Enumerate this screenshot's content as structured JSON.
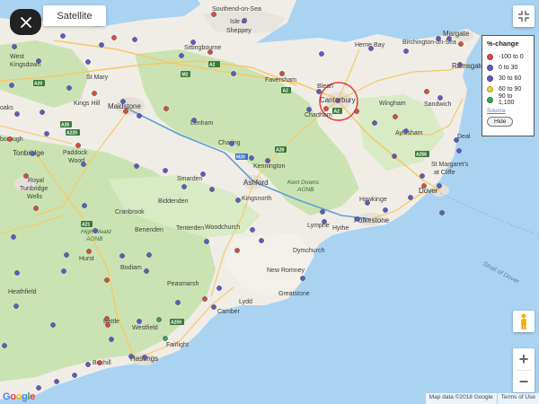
{
  "controls": {
    "satellite_label": "Satellite",
    "source_label": "Source",
    "hide_label": "Hide",
    "zoom_in": "+",
    "zoom_out": "−"
  },
  "legend": {
    "title": "%-change",
    "items": [
      {
        "label": "-100 to 0",
        "color": "#d94b3c"
      },
      {
        "label": "0 to 30",
        "color": "#5b5bc9"
      },
      {
        "label": "30 to 60",
        "color": "#6a55b0"
      },
      {
        "label": "60 to 90",
        "color": "#e8d23a"
      },
      {
        "label": "90 to 1,100",
        "color": "#3aa64e"
      }
    ]
  },
  "footer": {
    "map_data": "Map data ©2018 Google",
    "terms": "Terms of Use"
  },
  "logo_text": "Google",
  "labels": {
    "satellite_area": "Satellite",
    "southend": "Southend-on-Sea",
    "isle": "Isle of",
    "sheppey": "Sheppey",
    "sittingbourne": "Sittingbourne",
    "faversham": "Faversham",
    "herne_bay": "Herne Bay",
    "birchington": "Birchington-on-Sea",
    "margate": "Margate",
    "ramsgate": "Ramsgate",
    "wingham": "Wingham",
    "sandwich": "Sandwich",
    "blean": "Blean",
    "canterbury": "Canterbury",
    "chartham": "Chartham",
    "aylesham": "Aylesham",
    "deal": "Deal",
    "st_margarets1": "St Margaret's",
    "st_margarets2": "at Cliffe",
    "dover": "Dover",
    "hawkinge": "Hawkinge",
    "folkestone": "Folkestone",
    "hythe": "Hythe",
    "lympne": "Lympne",
    "kent_downs1": "Kent Downs",
    "kent_downs2": "AONB",
    "ashford": "Ashford",
    "kennington": "Kennington",
    "kingsnorth": "Kingsnorth",
    "smarden": "Smarden",
    "charing": "Charing",
    "lenham": "Lenham",
    "maidstone": "Maidstone",
    "kings_hill": "Kings Hill",
    "st_mary": "St Mary",
    "west_kingsdown": "West",
    "kingsdown": "Kingsdown",
    "oaks": "oaks",
    "tonbridge": "Tonbridge",
    "paddock_wood": "Paddock",
    "wood": "Wood",
    "borough": "borough",
    "royal": "Royal",
    "tunbridge": "Tunbridge",
    "wells": "Wells",
    "cranbrook": "Cranbrook",
    "biddenden": "Biddenden",
    "high_weald1": "High Weald",
    "high_weald2": "AONB",
    "benenden": "Benenden",
    "tenterden": "Tenterden",
    "woodchurch": "Woodchurch",
    "hurst": "Hurst",
    "dymchurch": "Dymchurch",
    "new_romney": "New Romney",
    "greatstone": "Greatstone",
    "lydd": "Lydd",
    "strait1": "Strait of Dover",
    "bodiam": "Bodiam",
    "heathfield": "Heathfield",
    "peasmarsh": "Peasmarsh",
    "camber": "Camber",
    "battle": "Battle",
    "westfield": "Westfield",
    "fairlight": "Fairlight",
    "hastings": "Hastings",
    "bexhill": "Bexhill",
    "s_m4": "M2",
    "s_a2": "A2",
    "s_a20": "A20",
    "s_a26": "A26",
    "s_a229": "A229",
    "s_m20": "M20",
    "s_a28": "A28",
    "s_a256": "A256",
    "s_a21": "A21",
    "s_a259": "A259",
    "s_a29": "A29",
    "s_m25": "M25"
  }
}
